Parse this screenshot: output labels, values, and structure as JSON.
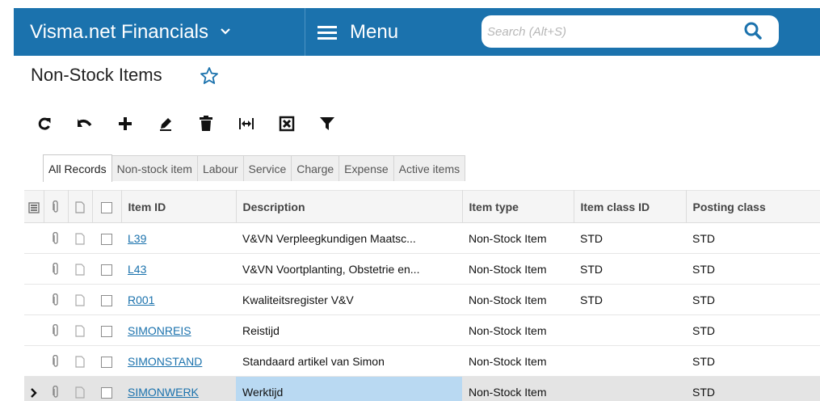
{
  "header": {
    "app_name": "Visma.net Financials",
    "menu_label": "Menu",
    "search_placeholder": "Search (Alt+S)",
    "search_value": ""
  },
  "page": {
    "title": "Non-Stock Items"
  },
  "toolbar": {
    "buttons": [
      "refresh",
      "undo",
      "add",
      "edit",
      "delete",
      "fit-columns",
      "export-excel",
      "filter"
    ]
  },
  "tabs": [
    "All Records",
    "Non-stock item",
    "Labour",
    "Service",
    "Charge",
    "Expense",
    "Active items"
  ],
  "active_tab": "All Records",
  "grid": {
    "columns": {
      "item_id": "Item ID",
      "description": "Description",
      "item_type": "Item type",
      "item_class_id": "Item class ID",
      "posting_class": "Posting class"
    },
    "rows": [
      {
        "item_id": "L39",
        "description": "V&VN Verpleegkundigen Maatsc...",
        "item_type": "Non-Stock Item",
        "item_class_id": "STD",
        "posting_class": "STD"
      },
      {
        "item_id": "L43",
        "description": "V&VN Voortplanting, Obstetrie en...",
        "item_type": "Non-Stock Item",
        "item_class_id": "STD",
        "posting_class": "STD"
      },
      {
        "item_id": "R001",
        "description": "Kwaliteitsregister V&V",
        "item_type": "Non-Stock Item",
        "item_class_id": "STD",
        "posting_class": "STD"
      },
      {
        "item_id": "SIMONREIS",
        "description": "Reistijd",
        "item_type": "Non-Stock Item",
        "item_class_id": "",
        "posting_class": "STD"
      },
      {
        "item_id": "SIMONSTAND",
        "description": "Standaard artikel van Simon",
        "item_type": "Non-Stock Item",
        "item_class_id": "",
        "posting_class": "STD"
      },
      {
        "item_id": "SIMONWERK",
        "description": "Werktijd",
        "item_type": "Non-Stock Item",
        "item_class_id": "",
        "posting_class": "STD"
      }
    ],
    "selected_row": "SIMONWERK"
  },
  "colors": {
    "header_bg": "#1b72ad",
    "link": "#1b72ad",
    "selected_cell": "#b9d9f2",
    "star": "#1b72ad"
  }
}
